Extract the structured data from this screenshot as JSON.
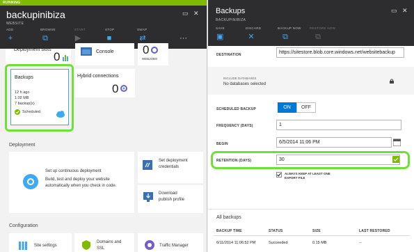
{
  "left_blade": {
    "status": "RUNNING",
    "title": "backupinibiza",
    "subtitle": "WEBSITE",
    "toolbar": [
      "ADD",
      "BROWSE",
      "START",
      "STOP",
      "SWAP"
    ],
    "tiles": {
      "deployment_slots": {
        "label": "Deployment slots",
        "value": "0"
      },
      "console": {
        "label": "Console"
      },
      "webjobs": {
        "value": "0",
        "label": "WEBJOBS"
      },
      "backups": {
        "label": "Backups",
        "line1": "12 h ago",
        "line2": "1.02 MB",
        "line3": "7 backup(s)",
        "status": "Scheduled"
      },
      "hybrid": {
        "label": "Hybrid connections",
        "value": "0"
      }
    },
    "deployment_section": "Deployment",
    "continuous": {
      "title": "Set up continuous deployment",
      "desc1": "Build, test and deploy your website",
      "desc2": "automatically when you check in code."
    },
    "set_credentials": {
      "line1": "Set deployment",
      "line2": "credentials"
    },
    "download_profile": {
      "line1": "Download",
      "line2": "publish profile"
    },
    "configuration_section": "Configuration",
    "config_tiles": {
      "site_settings": "Site settings",
      "domains_line1": "Domains and",
      "domains_line2": "SSL",
      "traffic": "Traffic Manager"
    }
  },
  "right_blade": {
    "title": "Backups",
    "subtitle": "BACKUPINIBIZA",
    "toolbar": [
      "SAVE",
      "DISCARD",
      "BACKUP NOW",
      "RESTORE NOW"
    ],
    "destination_label": "DESTINATION",
    "destination_value": "https://sitestore.blob.core.windows.net/websitebackup",
    "include_databases_label": "INCLUDE DATABASES",
    "include_databases_value": "No databases selected",
    "scheduled_backup_label": "SCHEDULED BACKUP",
    "toggle_on": "ON",
    "toggle_off": "OFF",
    "frequency_label": "FREQUENCY (DAYS)",
    "frequency_value": "1",
    "begin_label": "BEGIN",
    "begin_value": "6/5/2014 11:06 PM",
    "retention_label": "RETENTION (DAYS)",
    "retention_value": "30",
    "always_keep_line1": "ALWAYS KEEP AT LEAST ONE",
    "always_keep_line2": "EXPORT FILE",
    "all_backups": "All backups",
    "table": {
      "headers": [
        "BACKUP TIME",
        "STATUS",
        "SIZE",
        "LAST RESTORED"
      ],
      "rows": [
        [
          "6/11/2014 11:06:52 PM",
          "Succeeded",
          "0.15 MB",
          "--"
        ]
      ]
    }
  },
  "colors": {
    "accent": "#0078d7",
    "highlight": "#6fe03a",
    "running": "#7fba00",
    "header_bg": "#2d2d30"
  }
}
